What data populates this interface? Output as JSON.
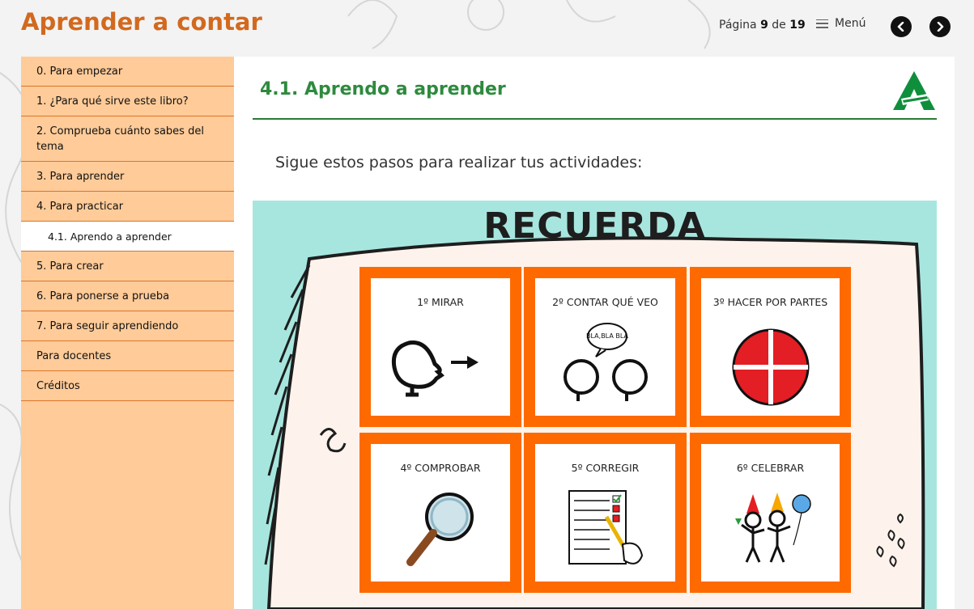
{
  "header": {
    "title": "Aprender a contar",
    "page_label": "Página",
    "page_current": "9",
    "page_of": "de",
    "page_total": "19",
    "menu_label": "Menú"
  },
  "sidebar": {
    "items": [
      {
        "label": "0. Para empezar"
      },
      {
        "label": "1. ¿Para qué sirve este libro?"
      },
      {
        "label": "2. Comprueba cuánto sabes del tema"
      },
      {
        "label": "3. Para aprender"
      },
      {
        "label": "4. Para practicar"
      },
      {
        "label": "4.1. Aprendo a aprender",
        "active": true
      },
      {
        "label": "5. Para crear"
      },
      {
        "label": "6. Para ponerse a prueba"
      },
      {
        "label": "7. Para seguir aprendiendo"
      },
      {
        "label": "Para docentes"
      },
      {
        "label": "Créditos"
      }
    ]
  },
  "main": {
    "title": "4.1. Aprendo a aprender",
    "intro": "Sigue estos pasos para realizar tus actividades:",
    "figure": {
      "heading": "RECUERDA",
      "steps": [
        {
          "label": "1º MIRAR",
          "icon": "look-icon"
        },
        {
          "label": "2º CONTAR QUÉ VEO",
          "icon": "talk-icon",
          "bubble": "BLA,BLA BLA"
        },
        {
          "label": "3º HACER POR PARTES",
          "icon": "parts-icon"
        },
        {
          "label": "4º COMPROBAR",
          "icon": "magnifier-icon"
        },
        {
          "label": "5º CORREGIR",
          "icon": "checklist-icon"
        },
        {
          "label": "6º CELEBRAR",
          "icon": "celebrate-icon"
        }
      ]
    }
  },
  "colors": {
    "title_orange": "#d2691e",
    "sidebar_bg": "#fecb99",
    "heading_green": "#2e8a3e",
    "figure_bg": "#a7e6de",
    "card_border": "#ff6a00"
  }
}
